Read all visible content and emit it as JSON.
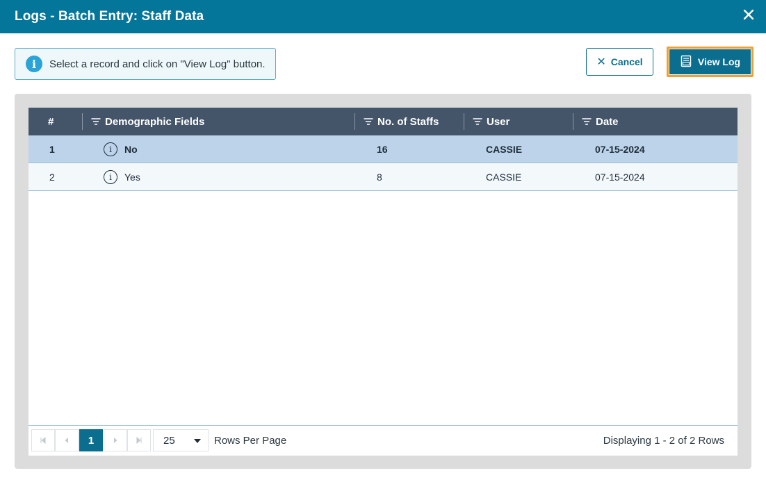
{
  "dialog": {
    "title": "Logs - Batch Entry: Staff Data",
    "close_icon": "close-icon"
  },
  "info": {
    "icon": "info-icon",
    "message": "Select a record and click on \"View Log\" button."
  },
  "actions": {
    "cancel_label": "Cancel",
    "cancel_icon": "close-icon",
    "view_log_label": "View Log",
    "view_log_icon": "log-icon"
  },
  "grid": {
    "columns": [
      {
        "label": "#",
        "filter": false
      },
      {
        "label": "Demographic Fields",
        "filter": true
      },
      {
        "label": "No. of Staffs",
        "filter": true
      },
      {
        "label": "User",
        "filter": true
      },
      {
        "label": "Date",
        "filter": true
      }
    ],
    "rows": [
      {
        "num": "1",
        "demographic": "No",
        "staffs": "16",
        "user": "CASSIE",
        "date": "07-15-2024",
        "selected": true
      },
      {
        "num": "2",
        "demographic": "Yes",
        "staffs": "8",
        "user": "CASSIE",
        "date": "07-15-2024",
        "selected": false
      }
    ]
  },
  "pagination": {
    "current_page": "1",
    "page_size": "25",
    "rows_per_page_label": "Rows Per Page",
    "display_info": "Displaying 1 - 2 of 2 Rows"
  },
  "colors": {
    "header_bg": "#03769a",
    "grid_header_bg": "#44556a",
    "accent": "#0b6e8f",
    "focus_outline": "#f0a031",
    "selected_row": "#bcd3ea"
  }
}
